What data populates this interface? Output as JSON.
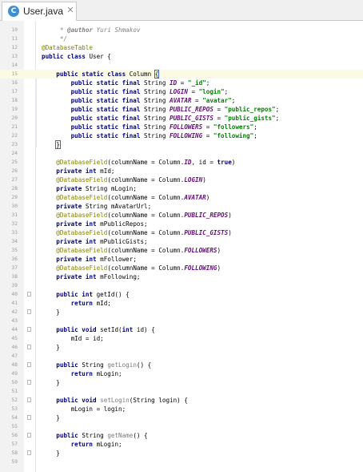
{
  "tab": {
    "label": "User.java",
    "icon": "class-icon",
    "icon_letter": "C",
    "close_symbol": "✕"
  },
  "colors": {
    "keyword": "#000080",
    "annotation": "#808000",
    "string": "#008000",
    "number": "#0000ff",
    "field": "#660e7a",
    "comment": "#808080"
  },
  "editor": {
    "lines": [
      {
        "n": 10,
        "t": [
          {
            "c": "cm",
            "v": "     * "
          },
          {
            "c": "tg",
            "v": "@author"
          },
          {
            "c": "cm",
            "v": " Yuri Shmakov"
          }
        ]
      },
      {
        "n": 11,
        "t": [
          {
            "c": "cm",
            "v": "     */"
          }
        ]
      },
      {
        "n": 12,
        "t": [
          {
            "c": "an",
            "v": "@DatabaseTable"
          }
        ]
      },
      {
        "n": 13,
        "t": [
          {
            "c": "kw",
            "v": "public class "
          },
          {
            "c": "",
            "v": "User {"
          }
        ]
      },
      {
        "n": 14,
        "t": []
      },
      {
        "n": 15,
        "hl": true,
        "t": [
          {
            "c": "",
            "v": "    "
          },
          {
            "c": "kw",
            "v": "public static class "
          },
          {
            "c": "",
            "v": "Column "
          },
          {
            "c": "brace",
            "v": "{"
          }
        ]
      },
      {
        "n": 16,
        "t": [
          {
            "c": "",
            "v": "        "
          },
          {
            "c": "kw",
            "v": "public static final "
          },
          {
            "c": "",
            "v": "String "
          },
          {
            "c": "fd",
            "v": "ID"
          },
          {
            "c": "",
            "v": " = "
          },
          {
            "c": "st",
            "v": "\"_id\""
          },
          {
            "c": "",
            "v": ";"
          }
        ]
      },
      {
        "n": 17,
        "t": [
          {
            "c": "",
            "v": "        "
          },
          {
            "c": "kw",
            "v": "public static final "
          },
          {
            "c": "",
            "v": "String "
          },
          {
            "c": "fd",
            "v": "LOGIN"
          },
          {
            "c": "",
            "v": " = "
          },
          {
            "c": "st",
            "v": "\"login\""
          },
          {
            "c": "",
            "v": ";"
          }
        ]
      },
      {
        "n": 18,
        "t": [
          {
            "c": "",
            "v": "        "
          },
          {
            "c": "kw",
            "v": "public static final "
          },
          {
            "c": "",
            "v": "String "
          },
          {
            "c": "fd",
            "v": "AVATAR"
          },
          {
            "c": "",
            "v": " = "
          },
          {
            "c": "st",
            "v": "\"avatar\""
          },
          {
            "c": "",
            "v": ";"
          }
        ]
      },
      {
        "n": 19,
        "t": [
          {
            "c": "",
            "v": "        "
          },
          {
            "c": "kw",
            "v": "public static final "
          },
          {
            "c": "",
            "v": "String "
          },
          {
            "c": "fd",
            "v": "PUBLIC_REPOS"
          },
          {
            "c": "",
            "v": " = "
          },
          {
            "c": "st",
            "v": "\"public_repos\""
          },
          {
            "c": "",
            "v": ";"
          }
        ]
      },
      {
        "n": 20,
        "t": [
          {
            "c": "",
            "v": "        "
          },
          {
            "c": "kw",
            "v": "public static final "
          },
          {
            "c": "",
            "v": "String "
          },
          {
            "c": "fd",
            "v": "PUBLIC_GISTS"
          },
          {
            "c": "",
            "v": " = "
          },
          {
            "c": "st",
            "v": "\"public_gists\""
          },
          {
            "c": "",
            "v": ";"
          }
        ]
      },
      {
        "n": 21,
        "t": [
          {
            "c": "",
            "v": "        "
          },
          {
            "c": "kw",
            "v": "public static final "
          },
          {
            "c": "",
            "v": "String "
          },
          {
            "c": "fd",
            "v": "FOLLOWERS"
          },
          {
            "c": "",
            "v": " = "
          },
          {
            "c": "st",
            "v": "\"followers\""
          },
          {
            "c": "",
            "v": ";"
          }
        ]
      },
      {
        "n": 22,
        "t": [
          {
            "c": "",
            "v": "        "
          },
          {
            "c": "kw",
            "v": "public static final "
          },
          {
            "c": "",
            "v": "String "
          },
          {
            "c": "fd",
            "v": "FOLLOWING"
          },
          {
            "c": "",
            "v": " = "
          },
          {
            "c": "st",
            "v": "\"following\""
          },
          {
            "c": "",
            "v": ";"
          }
        ]
      },
      {
        "n": 23,
        "t": [
          {
            "c": "",
            "v": "    "
          },
          {
            "c": "brace",
            "v": "}"
          }
        ]
      },
      {
        "n": 24,
        "t": []
      },
      {
        "n": 25,
        "t": [
          {
            "c": "",
            "v": "    "
          },
          {
            "c": "an",
            "v": "@DatabaseField"
          },
          {
            "c": "",
            "v": "(columnName = Column."
          },
          {
            "c": "fd",
            "v": "ID"
          },
          {
            "c": "",
            "v": ", id = "
          },
          {
            "c": "kw",
            "v": "true"
          },
          {
            "c": "",
            "v": ")"
          }
        ]
      },
      {
        "n": 26,
        "t": [
          {
            "c": "",
            "v": "    "
          },
          {
            "c": "kw",
            "v": "private int "
          },
          {
            "c": "",
            "v": "mId;"
          }
        ]
      },
      {
        "n": 27,
        "t": [
          {
            "c": "",
            "v": "    "
          },
          {
            "c": "an",
            "v": "@DatabaseField"
          },
          {
            "c": "",
            "v": "(columnName = Column."
          },
          {
            "c": "fd",
            "v": "LOGIN"
          },
          {
            "c": "",
            "v": ")"
          }
        ]
      },
      {
        "n": 28,
        "t": [
          {
            "c": "",
            "v": "    "
          },
          {
            "c": "kw",
            "v": "private "
          },
          {
            "c": "",
            "v": "String mLogin;"
          }
        ]
      },
      {
        "n": 29,
        "t": [
          {
            "c": "",
            "v": "    "
          },
          {
            "c": "an",
            "v": "@DatabaseField"
          },
          {
            "c": "",
            "v": "(columnName = Column."
          },
          {
            "c": "fd",
            "v": "AVATAR"
          },
          {
            "c": "",
            "v": ")"
          }
        ]
      },
      {
        "n": 30,
        "t": [
          {
            "c": "",
            "v": "    "
          },
          {
            "c": "kw",
            "v": "private "
          },
          {
            "c": "",
            "v": "String mAvatarUrl;"
          }
        ]
      },
      {
        "n": 31,
        "t": [
          {
            "c": "",
            "v": "    "
          },
          {
            "c": "an",
            "v": "@DatabaseField"
          },
          {
            "c": "",
            "v": "(columnName = Column."
          },
          {
            "c": "fd",
            "v": "PUBLIC_REPOS"
          },
          {
            "c": "",
            "v": ")"
          }
        ]
      },
      {
        "n": 32,
        "t": [
          {
            "c": "",
            "v": "    "
          },
          {
            "c": "kw",
            "v": "private int "
          },
          {
            "c": "",
            "v": "mPublicRepos;"
          }
        ]
      },
      {
        "n": 33,
        "t": [
          {
            "c": "",
            "v": "    "
          },
          {
            "c": "an",
            "v": "@DatabaseField"
          },
          {
            "c": "",
            "v": "(columnName = Column."
          },
          {
            "c": "fd",
            "v": "PUBLIC_GISTS"
          },
          {
            "c": "",
            "v": ")"
          }
        ]
      },
      {
        "n": 34,
        "t": [
          {
            "c": "",
            "v": "    "
          },
          {
            "c": "kw",
            "v": "private int "
          },
          {
            "c": "",
            "v": "mPublicGists;"
          }
        ]
      },
      {
        "n": 35,
        "t": [
          {
            "c": "",
            "v": "    "
          },
          {
            "c": "an",
            "v": "@DatabaseField"
          },
          {
            "c": "",
            "v": "(columnName = Column."
          },
          {
            "c": "fd",
            "v": "FOLLOWERS"
          },
          {
            "c": "",
            "v": ")"
          }
        ]
      },
      {
        "n": 36,
        "t": [
          {
            "c": "",
            "v": "    "
          },
          {
            "c": "kw",
            "v": "private int "
          },
          {
            "c": "",
            "v": "mFollower;"
          }
        ]
      },
      {
        "n": 37,
        "t": [
          {
            "c": "",
            "v": "    "
          },
          {
            "c": "an",
            "v": "@DatabaseField"
          },
          {
            "c": "",
            "v": "(columnName = Column."
          },
          {
            "c": "fd",
            "v": "FOLLOWING"
          },
          {
            "c": "",
            "v": ")"
          }
        ]
      },
      {
        "n": 38,
        "t": [
          {
            "c": "",
            "v": "    "
          },
          {
            "c": "kw",
            "v": "private int "
          },
          {
            "c": "",
            "v": "mFollowing;"
          }
        ]
      },
      {
        "n": 39,
        "t": []
      },
      {
        "n": 40,
        "fold": true,
        "t": [
          {
            "c": "",
            "v": "    "
          },
          {
            "c": "kw",
            "v": "public int "
          },
          {
            "c": "",
            "v": "getId() {"
          }
        ]
      },
      {
        "n": 41,
        "t": [
          {
            "c": "",
            "v": "        "
          },
          {
            "c": "kw",
            "v": "return "
          },
          {
            "c": "",
            "v": "mId;"
          }
        ]
      },
      {
        "n": 42,
        "fold": true,
        "t": [
          {
            "c": "",
            "v": "    }"
          }
        ]
      },
      {
        "n": 43,
        "t": []
      },
      {
        "n": 44,
        "fold": true,
        "t": [
          {
            "c": "",
            "v": "    "
          },
          {
            "c": "kw",
            "v": "public void "
          },
          {
            "c": "",
            "v": "setId("
          },
          {
            "c": "kw",
            "v": "int "
          },
          {
            "c": "",
            "v": "id) {"
          }
        ]
      },
      {
        "n": 45,
        "t": [
          {
            "c": "",
            "v": "        mId = id;"
          }
        ]
      },
      {
        "n": 46,
        "fold": true,
        "t": [
          {
            "c": "",
            "v": "    }"
          }
        ]
      },
      {
        "n": 47,
        "t": []
      },
      {
        "n": 48,
        "fold": true,
        "t": [
          {
            "c": "",
            "v": "    "
          },
          {
            "c": "kw",
            "v": "public "
          },
          {
            "c": "",
            "v": "String "
          },
          {
            "c": "mt",
            "v": "getLogin"
          },
          {
            "c": "",
            "v": "() {"
          }
        ]
      },
      {
        "n": 49,
        "t": [
          {
            "c": "",
            "v": "        "
          },
          {
            "c": "kw",
            "v": "return "
          },
          {
            "c": "",
            "v": "mLogin;"
          }
        ]
      },
      {
        "n": 50,
        "fold": true,
        "t": [
          {
            "c": "",
            "v": "    }"
          }
        ]
      },
      {
        "n": 51,
        "t": []
      },
      {
        "n": 52,
        "fold": true,
        "t": [
          {
            "c": "",
            "v": "    "
          },
          {
            "c": "kw",
            "v": "public void "
          },
          {
            "c": "mt",
            "v": "setLogin"
          },
          {
            "c": "",
            "v": "(String login) {"
          }
        ]
      },
      {
        "n": 53,
        "t": [
          {
            "c": "",
            "v": "        mLogin = login;"
          }
        ]
      },
      {
        "n": 54,
        "fold": true,
        "t": [
          {
            "c": "",
            "v": "    }"
          }
        ]
      },
      {
        "n": 55,
        "t": []
      },
      {
        "n": 56,
        "fold": true,
        "t": [
          {
            "c": "",
            "v": "    "
          },
          {
            "c": "kw",
            "v": "public "
          },
          {
            "c": "",
            "v": "String "
          },
          {
            "c": "mt",
            "v": "getName"
          },
          {
            "c": "",
            "v": "() {"
          }
        ]
      },
      {
        "n": 57,
        "t": [
          {
            "c": "",
            "v": "        "
          },
          {
            "c": "kw",
            "v": "return "
          },
          {
            "c": "",
            "v": "mLogin;"
          }
        ]
      },
      {
        "n": 58,
        "fold": true,
        "t": [
          {
            "c": "",
            "v": "    }"
          }
        ]
      },
      {
        "n": 59,
        "t": []
      }
    ]
  }
}
